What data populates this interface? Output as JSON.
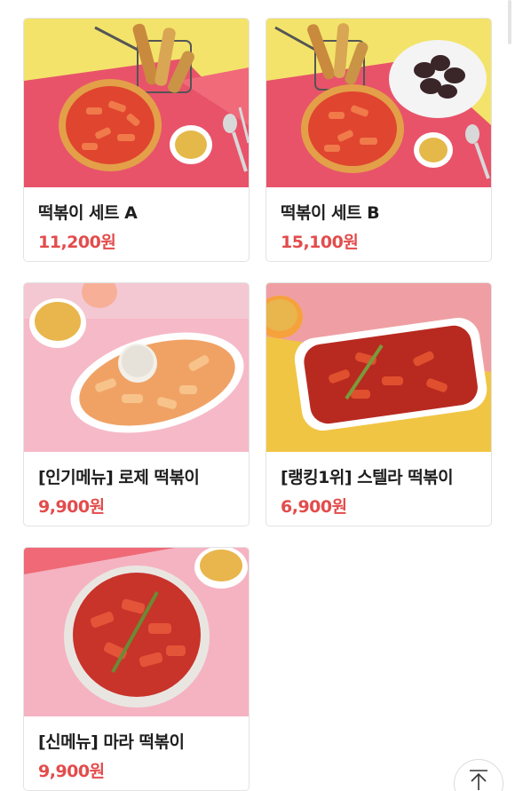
{
  "menu": {
    "items": [
      {
        "name": "떡볶이 세트 A",
        "price": "11,200원"
      },
      {
        "name": "떡볶이 세트 B",
        "price": "15,100원"
      },
      {
        "name": "[인기메뉴] 로제 떡볶이",
        "price": "9,900원"
      },
      {
        "name": "[랭킹1위] 스텔라 떡볶이",
        "price": "6,900원"
      },
      {
        "name": "[신메뉴] 마라 떡볶이",
        "price": "9,900원"
      }
    ]
  },
  "icons": {
    "scroll_top": "arrow-up-to-line-icon"
  },
  "colors": {
    "price": "#e34c4c",
    "name": "#1e1e1e",
    "card_border": "#e3e3e3"
  }
}
